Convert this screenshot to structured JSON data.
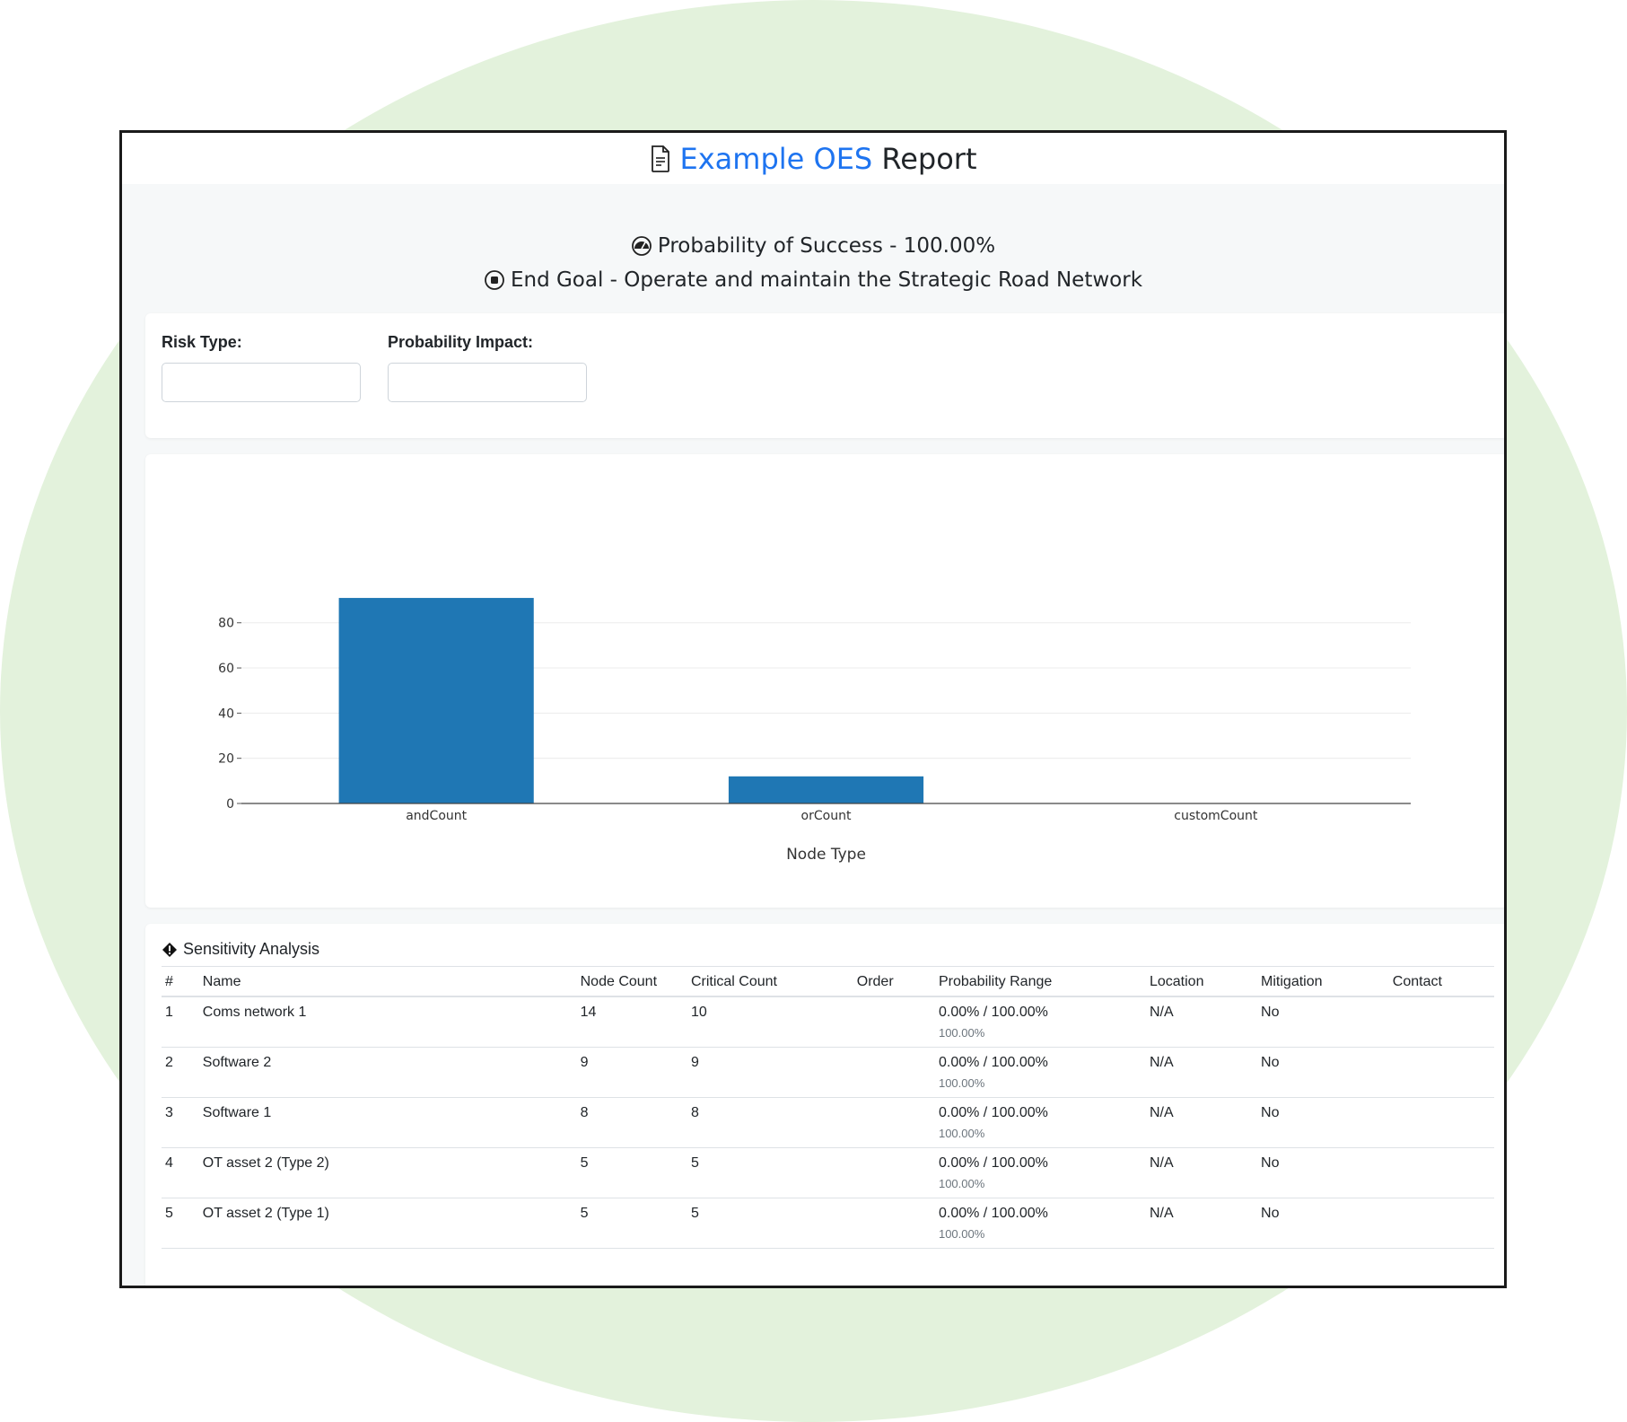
{
  "report": {
    "title_accent": "Example OES",
    "title_rest": "Report",
    "probability_line": "Probability of Success - 100.00%",
    "goal_line": "End Goal - Operate and maintain the Strategic Road Network"
  },
  "filters": {
    "risk_type_label": "Risk Type:",
    "probability_impact_label": "Probability Impact:"
  },
  "chart_data": {
    "type": "bar",
    "categories": [
      "andCount",
      "orCount",
      "customCount"
    ],
    "values": [
      91,
      12,
      0
    ],
    "xlabel": "Node Type",
    "ylabel": "",
    "ylim": [
      0,
      95
    ],
    "yticks": [
      0,
      20,
      40,
      60,
      80
    ],
    "grid": true,
    "colors": {
      "bar": "#1f77b4"
    }
  },
  "sensitivity": {
    "title": "Sensitivity Analysis",
    "columns": [
      "#",
      "Name",
      "Node Count",
      "Critical Count",
      "Order",
      "Probability Range",
      "Location",
      "Mitigation",
      "Contact"
    ],
    "rows": [
      {
        "num": "1",
        "name": "Coms network 1",
        "node_count": "14",
        "critical_count": "10",
        "order": "",
        "range": "0.00% / 100.00%",
        "range_sub": "100.00%",
        "location": "N/A",
        "mitigation": "No",
        "contact": ""
      },
      {
        "num": "2",
        "name": "Software 2",
        "node_count": "9",
        "critical_count": "9",
        "order": "",
        "range": "0.00% / 100.00%",
        "range_sub": "100.00%",
        "location": "N/A",
        "mitigation": "No",
        "contact": ""
      },
      {
        "num": "3",
        "name": "Software 1",
        "node_count": "8",
        "critical_count": "8",
        "order": "",
        "range": "0.00% / 100.00%",
        "range_sub": "100.00%",
        "location": "N/A",
        "mitigation": "No",
        "contact": ""
      },
      {
        "num": "4",
        "name": "OT asset 2 (Type 2)",
        "node_count": "5",
        "critical_count": "5",
        "order": "",
        "range": "0.00% / 100.00%",
        "range_sub": "100.00%",
        "location": "N/A",
        "mitigation": "No",
        "contact": ""
      },
      {
        "num": "5",
        "name": "OT asset 2 (Type 1)",
        "node_count": "5",
        "critical_count": "5",
        "order": "",
        "range": "0.00% / 100.00%",
        "range_sub": "100.00%",
        "location": "N/A",
        "mitigation": "No",
        "contact": ""
      }
    ]
  }
}
